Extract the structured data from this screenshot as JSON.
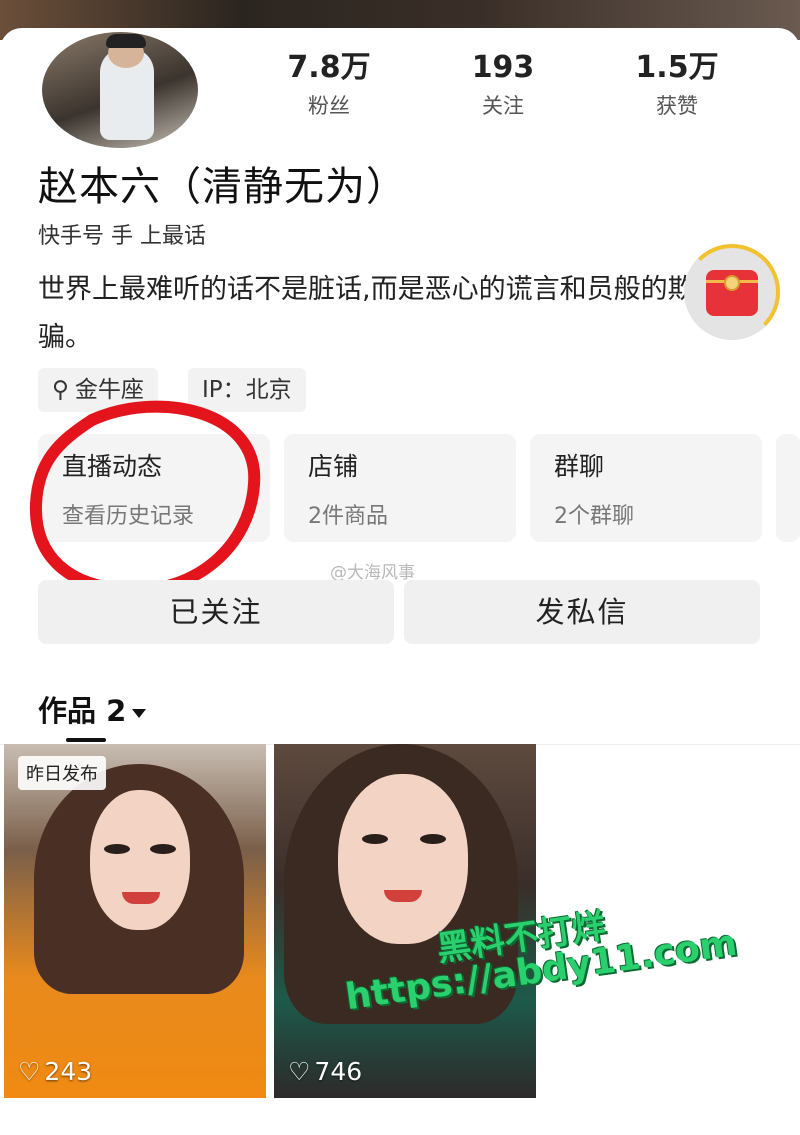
{
  "profile": {
    "name": "赵本六（清静无为）",
    "kuaishou_id": "快手号 手 上最话",
    "bio": "世界上最难听的话不是脏话,而是恶心的谎言和员般的欺骗。",
    "tags": [
      {
        "icon": "search-icon",
        "label": "金牛座"
      },
      {
        "label": "IP：北京"
      }
    ]
  },
  "stats": [
    {
      "value": "7.8万",
      "label": "粉丝"
    },
    {
      "value": "193",
      "label": "关注"
    },
    {
      "value": "1.5万",
      "label": "获赞"
    }
  ],
  "tiles": [
    {
      "title": "直播动态",
      "subtitle": "查看历史记录"
    },
    {
      "title": "店铺",
      "subtitle": "2件商品"
    },
    {
      "title": "群聊",
      "subtitle": "2个群聊"
    }
  ],
  "actions": {
    "follow": "已关注",
    "message": "发私信"
  },
  "weibo_watermark": "@大海风事",
  "works": {
    "title": "作品 2",
    "items": [
      {
        "badge": "昨日发布",
        "likes": "243"
      },
      {
        "likes": "746"
      }
    ]
  },
  "watermark": {
    "line1": "黑料不打烊",
    "line2": "https://abdy11.com"
  },
  "colors": {
    "annotation_red": "#e3141c",
    "watermark_green": "#2ad06e",
    "red_packet": "#e8323a"
  }
}
